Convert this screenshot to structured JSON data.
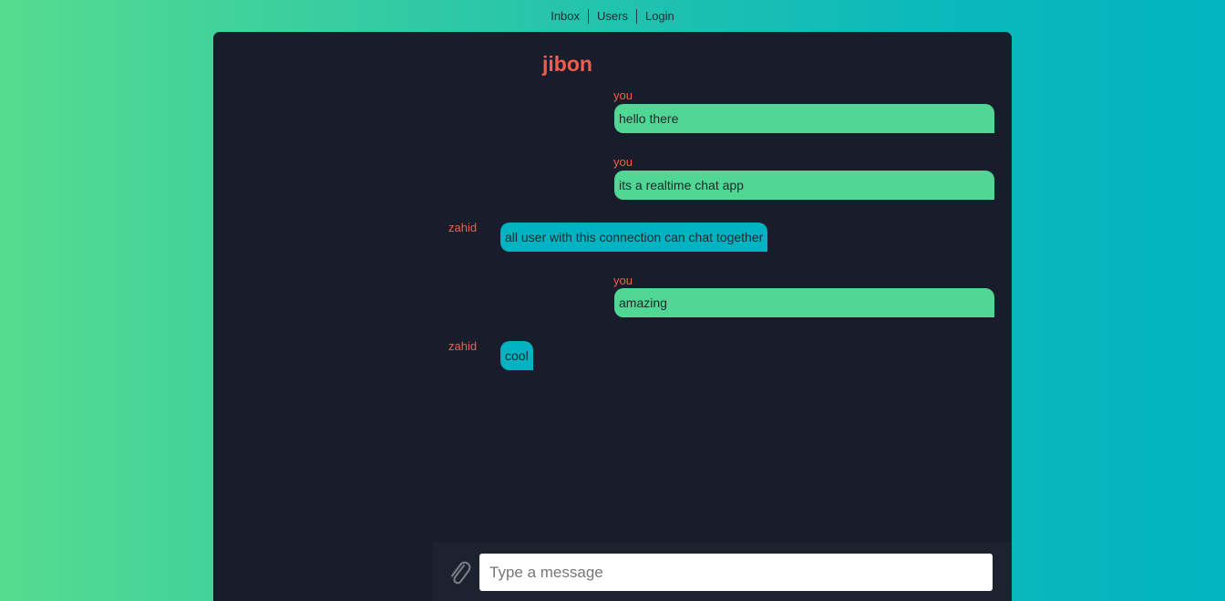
{
  "nav": {
    "items": [
      "Inbox",
      "Users",
      "Login"
    ]
  },
  "chat": {
    "title": "jibon",
    "messages": [
      {
        "sender": "you",
        "text": "hello there",
        "mine": true
      },
      {
        "sender": "you",
        "text": "its a realtime chat app",
        "mine": true
      },
      {
        "sender": "zahid",
        "text": "all user with this connection can chat together",
        "mine": false
      },
      {
        "sender": "you",
        "text": "amazing",
        "mine": true
      },
      {
        "sender": "zahid",
        "text": "cool",
        "mine": false
      }
    ]
  },
  "composer": {
    "placeholder": "Type a message",
    "value": ""
  },
  "colors": {
    "accent": "#f25e4a",
    "mine_bubble": "#50d794",
    "theirs_bubble": "#00b3c2",
    "panel": "#191d2b"
  },
  "icons": {
    "attach": "paperclip-icon"
  }
}
